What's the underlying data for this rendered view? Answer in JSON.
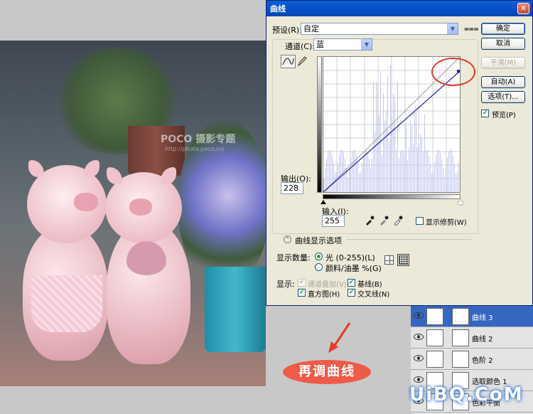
{
  "dialog": {
    "title": "曲线",
    "preset": {
      "label": "预设(R):",
      "value": "自定"
    },
    "channel": {
      "label": "通道(C):",
      "value": "蓝"
    },
    "output": {
      "label": "输出(O):",
      "value": "228"
    },
    "input": {
      "label": "输入(I):",
      "value": "255"
    },
    "show_clipping": {
      "label": "显示修剪(W)",
      "checked": false
    },
    "curve_display_options": "曲线显示选项",
    "show_amount": {
      "label": "显示数量:",
      "options": [
        {
          "label": "光 (0-255)(L)",
          "selected": true
        },
        {
          "label": "颜料/油墨 %(G)",
          "selected": false
        }
      ]
    },
    "show": {
      "label": "显示:",
      "options": [
        {
          "label": "通道叠加(V)",
          "checked": true,
          "disabled": true
        },
        {
          "label": "基线(B)",
          "checked": true
        },
        {
          "label": "直方图(H)",
          "checked": true
        },
        {
          "label": "交叉线(N)",
          "checked": true
        }
      ]
    },
    "buttons": {
      "ok": "确定",
      "cancel": "取消",
      "smooth": "平滑(M)",
      "auto": "自动(A)",
      "options": "选项(T)..."
    },
    "preview": {
      "label": "预览(P)",
      "checked": true
    },
    "curve_points": [
      {
        "input": 0,
        "output": 0
      },
      {
        "input": 255,
        "output": 228
      }
    ]
  },
  "photo": {
    "watermark": "POCO 摄影专题",
    "watermark_url": "http://photo.poco.cn/"
  },
  "layers": [
    {
      "name": "曲线 3",
      "selected": true
    },
    {
      "name": "曲线 2",
      "selected": false
    },
    {
      "name": "色阶 2",
      "selected": false
    },
    {
      "name": "选取颜色 1",
      "selected": false
    },
    {
      "name": "色彩平衡",
      "selected": false
    }
  ],
  "annotation": "再调曲线",
  "brand": "UiBQ.CoM",
  "colors": {
    "accent": "#0a5fd8",
    "callout": "#f05a48",
    "highlight_circle": "#e8392b",
    "curve": "#1d1db8"
  }
}
